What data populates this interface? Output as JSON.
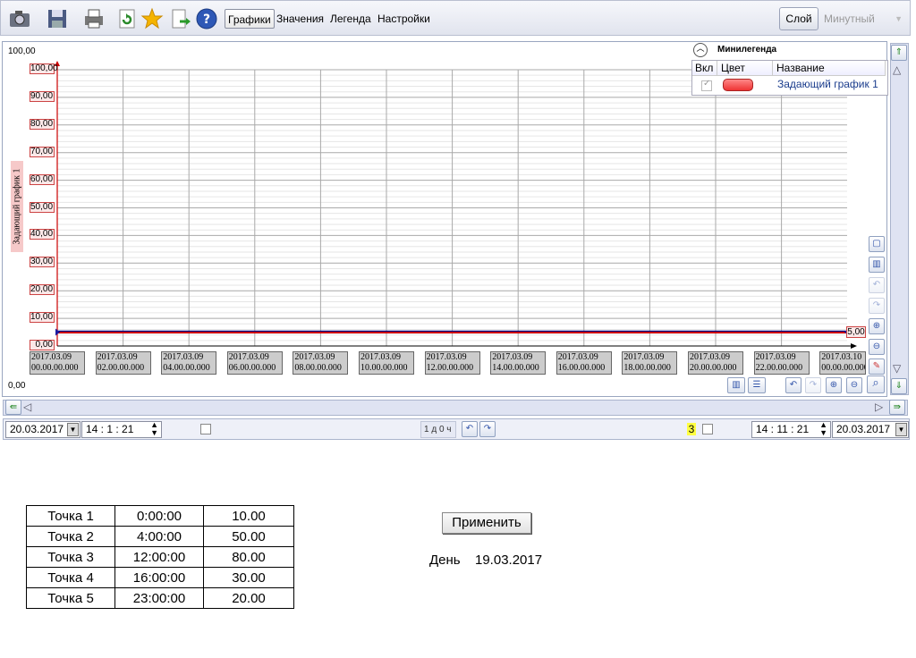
{
  "toolbar": {
    "icons": [
      "camera-icon",
      "save-icon",
      "print-icon",
      "refresh-icon",
      "star-icon",
      "export-icon",
      "help-icon"
    ],
    "tabs": [
      {
        "label": "Графики",
        "active": true
      },
      {
        "label": "Значения",
        "active": false
      },
      {
        "label": "Легенда",
        "active": false
      },
      {
        "label": "Настройки",
        "active": false
      }
    ],
    "layer_button": "Слой",
    "period": "Минутный"
  },
  "chart": {
    "scale_max": "100,00",
    "scale_min": "0,00",
    "y_axis_label": "Задающий график 1",
    "current_value_label": "5,00"
  },
  "chart_data": {
    "type": "line",
    "title": "",
    "ylabel": "Задающий график 1",
    "ylim": [
      0,
      100
    ],
    "yticks": [
      "100,00",
      "90,00",
      "80,00",
      "70,00",
      "60,00",
      "50,00",
      "40,00",
      "30,00",
      "20,00",
      "10,00",
      "0,00"
    ],
    "xticks": [
      [
        "2017.03.09",
        "00.00.00.000"
      ],
      [
        "2017.03.09",
        "02.00.00.000"
      ],
      [
        "2017.03.09",
        "04.00.00.000"
      ],
      [
        "2017.03.09",
        "06.00.00.000"
      ],
      [
        "2017.03.09",
        "08.00.00.000"
      ],
      [
        "2017.03.09",
        "10.00.00.000"
      ],
      [
        "2017.03.09",
        "12.00.00.000"
      ],
      [
        "2017.03.09",
        "14.00.00.000"
      ],
      [
        "2017.03.09",
        "16.00.00.000"
      ],
      [
        "2017.03.09",
        "18.00.00.000"
      ],
      [
        "2017.03.09",
        "20.00.00.000"
      ],
      [
        "2017.03.09",
        "22.00.00.000"
      ],
      [
        "2017.03.10",
        "00.00.00.000"
      ]
    ],
    "series": [
      {
        "name": "Задающий график 1",
        "color": "#cc0000",
        "values": [
          5,
          5
        ]
      }
    ],
    "grid": true
  },
  "minilegend": {
    "title": "Минилегенда",
    "headers": {
      "enabled": "Вкл",
      "color": "Цвет",
      "name": "Название"
    },
    "rows": [
      {
        "enabled": true,
        "color": "#e84040",
        "name": "Задающий график 1"
      }
    ]
  },
  "timebar": {
    "start_date": "20.03.2017",
    "start_time": "14 : 1 : 21",
    "range": "1 д 0 ч",
    "marker": "3",
    "end_time": "14 : 11 : 21",
    "end_date": "20.03.2017"
  },
  "points": [
    [
      "Точка 1",
      "0:00:00",
      "10.00"
    ],
    [
      "Точка 2",
      "4:00:00",
      "50.00"
    ],
    [
      "Точка 3",
      "12:00:00",
      "80.00"
    ],
    [
      "Точка 4",
      "16:00:00",
      "30.00"
    ],
    [
      "Точка 5",
      "23:00:00",
      "20.00"
    ]
  ],
  "apply_label": "Применить",
  "day_label": "День",
  "day_value": "19.03.2017"
}
